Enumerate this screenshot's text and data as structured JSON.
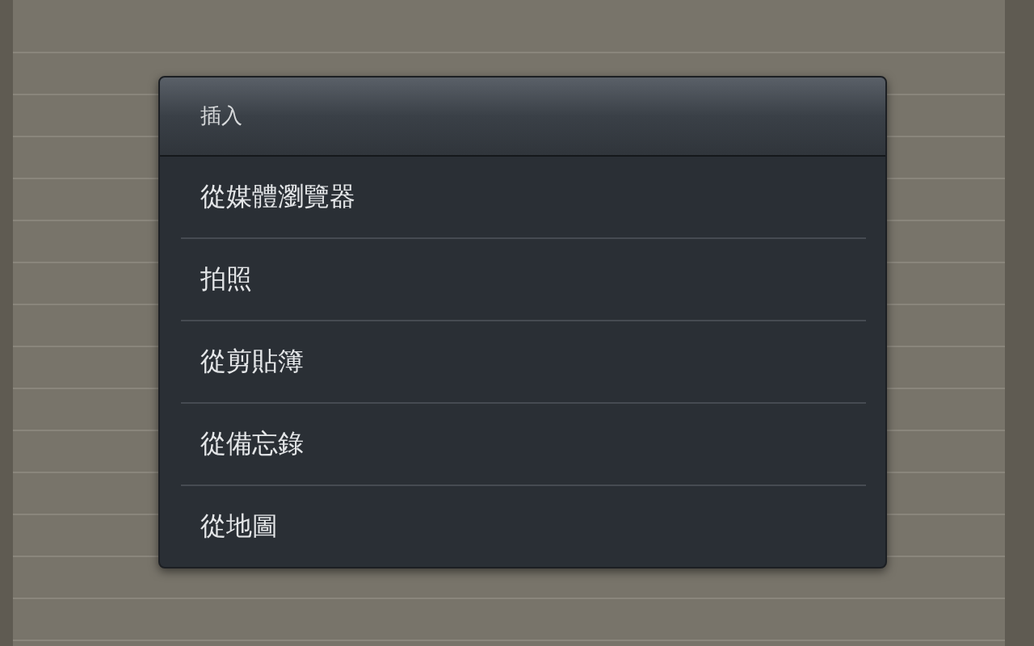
{
  "dialog": {
    "title": "插入",
    "items": [
      {
        "label": "從媒體瀏覽器"
      },
      {
        "label": "拍照"
      },
      {
        "label": "從剪貼簿"
      },
      {
        "label": "從備忘錄"
      },
      {
        "label": "從地圖"
      }
    ]
  }
}
